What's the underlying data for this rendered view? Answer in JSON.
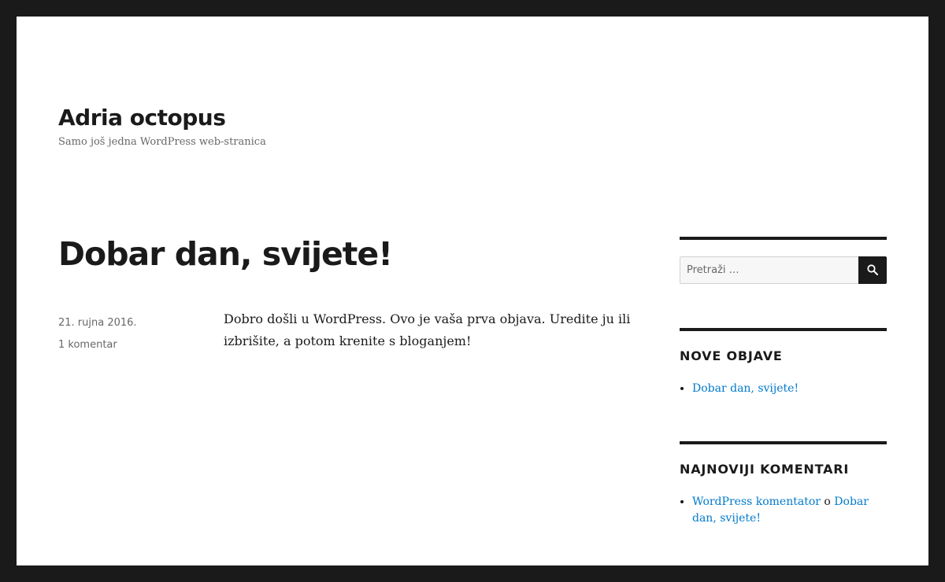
{
  "site": {
    "title": "Adria octopus",
    "description": "Samo još jedna WordPress web-stranica"
  },
  "post": {
    "title": "Dobar dan, svijete!",
    "date": "21. rujna 2016.",
    "comments": "1 komentar",
    "content": "Dobro došli u WordPress. Ovo je vaša prva objava. Uredite ju ili izbrišite, a potom krenite s bloganjem!"
  },
  "sidebar": {
    "search": {
      "placeholder": "Pretraži …",
      "icon": "search-icon"
    },
    "recent_posts": {
      "title": "NOVE OBJAVE",
      "items": [
        "Dobar dan, svijete!"
      ]
    },
    "recent_comments": {
      "title": "NAJNOVIJI KOMENTARI",
      "items": [
        {
          "author": "WordPress komentator",
          "separator": "o",
          "post": "Dobar dan, svijete!"
        }
      ]
    }
  },
  "colors": {
    "frame": "#1a1a1a",
    "text": "#1a1a1a",
    "meta": "#686868",
    "link": "#007acc"
  }
}
